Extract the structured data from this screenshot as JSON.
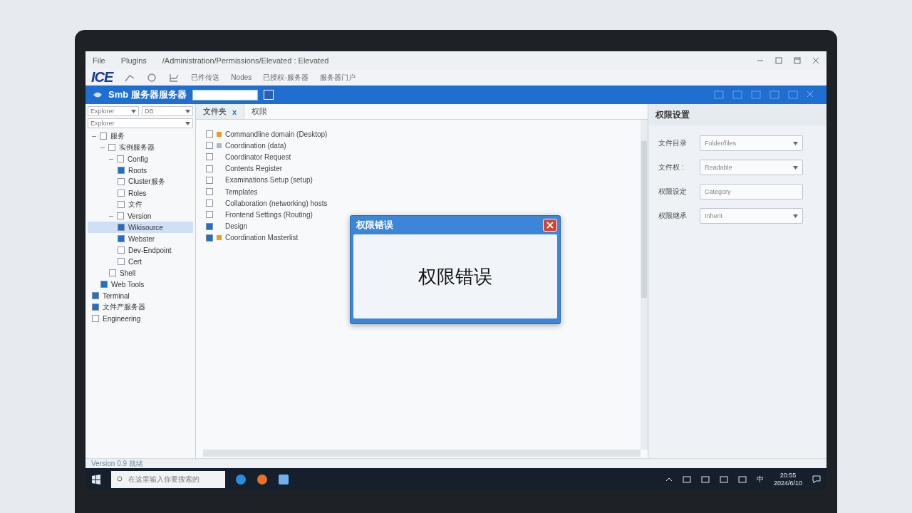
{
  "window": {
    "menu": [
      "File",
      "Plugins"
    ],
    "path": "/Administration/Permissions/Elevated : Elevated"
  },
  "toolbar": {
    "logo": "ICE",
    "actions": [
      "已件传送",
      "Nodes",
      "已授权-服务器",
      "服务器门户"
    ]
  },
  "header": {
    "title": "Smb 服务器服务器"
  },
  "sidebar": {
    "dropdowns": [
      {
        "value": "Explorer"
      },
      {
        "value": "DB"
      }
    ],
    "filter": "Explorer",
    "tree": [
      {
        "label": "服务",
        "checked": false,
        "selected": false,
        "children": [
          {
            "label": "实例服务器",
            "checked": false,
            "selected": false,
            "children": [
              {
                "label": "Config",
                "checked": false,
                "selected": false,
                "children": [
                  {
                    "label": "Roots",
                    "checked": true,
                    "selected": false
                  },
                  {
                    "label": "Cluster服务",
                    "checked": false,
                    "selected": false
                  },
                  {
                    "label": "Roles",
                    "checked": false,
                    "selected": false
                  },
                  {
                    "label": "文件",
                    "checked": false,
                    "selected": false
                  }
                ]
              },
              {
                "label": "Version",
                "checked": false,
                "selected": false,
                "children": [
                  {
                    "label": "Wikisource",
                    "checked": true,
                    "selected": true
                  },
                  {
                    "label": "Webster",
                    "checked": true,
                    "selected": false
                  },
                  {
                    "label": "Dev-Endpoint",
                    "checked": false,
                    "selected": false
                  },
                  {
                    "label": "Cert",
                    "checked": false,
                    "selected": false
                  }
                ]
              },
              {
                "label": "Shell",
                "checked": false,
                "selected": false
              }
            ]
          },
          {
            "label": "Web Tools",
            "checked": true,
            "selected": false
          }
        ]
      },
      {
        "label": "Terminal",
        "checked": true,
        "selected": false
      },
      {
        "label": "文件产服务器",
        "checked": true,
        "selected": false
      },
      {
        "label": "Engineering",
        "checked": false,
        "selected": false
      }
    ]
  },
  "tabs": [
    {
      "label": "文件夹",
      "selected": true,
      "close": "x"
    },
    {
      "label": "权限",
      "selected": false
    }
  ],
  "file_list": [
    {
      "label": "Commandline domain (Desktop)",
      "checked": false,
      "color": "#e8a020"
    },
    {
      "label": "Coordination (data)",
      "checked": false,
      "color": "#b0b8c0"
    },
    {
      "label": "Coordinator Request",
      "checked": false
    },
    {
      "label": "Contents Register",
      "checked": false
    },
    {
      "label": "Examinations Setup (setup)",
      "checked": false
    },
    {
      "label": "Templates",
      "checked": false
    },
    {
      "label": "Collaboration (networking) hosts",
      "checked": false
    },
    {
      "label": "Frontend Settings (Routing)",
      "checked": false
    },
    {
      "label": "Design",
      "checked": true
    },
    {
      "label": "Coordination Masterlist",
      "checked": true,
      "color": "#e8a020"
    }
  ],
  "properties": {
    "title": "权限设置",
    "fields": [
      {
        "label": "文件目录",
        "value": "Folder/files",
        "kind": "select"
      },
      {
        "label": "文件权 :",
        "value": "Readable",
        "kind": "select"
      },
      {
        "label": "权限设定",
        "value": "Category",
        "kind": "text"
      },
      {
        "label": "权限继承",
        "value": "Inherit",
        "kind": "select"
      }
    ]
  },
  "dialog": {
    "title": "权限错误",
    "message": "权限错误"
  },
  "status_bar": {
    "text": "Version 0.9 就绪"
  },
  "taskbar": {
    "search_placeholder": "在这里输入你要搜索的",
    "time": "20:55",
    "date": "2024/6/10",
    "lang": "中"
  }
}
